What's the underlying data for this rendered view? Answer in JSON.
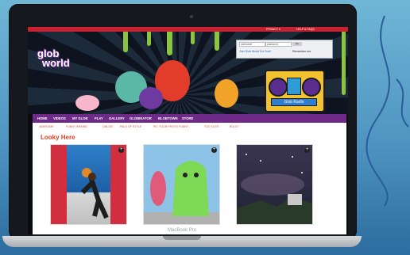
{
  "laptop": {
    "brand_text": "MacBook Pro"
  },
  "site": {
    "logo": {
      "line1": "glob",
      "line2": "world"
    },
    "topbar_links": [
      "PRIVACY ▾",
      "HELP & FAQS"
    ],
    "login": {
      "username_placeholder": "username",
      "password_placeholder": "password",
      "go": "Go",
      "forgot": "Join Glob World For Free!",
      "remember": "Remember me"
    },
    "boombox_label": "Glob Radio",
    "nav": {
      "items": [
        "HOME",
        "VIDEOS",
        "MY GLOB",
        "PLAY",
        "GALLERY",
        "GLOBINATOR",
        "BLOBTOWN",
        "STORE"
      ]
    },
    "subnav": {
      "items": [
        "AWESOME",
        "FUNNY BRAINS",
        "LIBLOB",
        "PALS OF STYLE",
        "PIC YOUR PHOTO FUNNY",
        "TOO CUTE",
        "BOLD!"
      ]
    },
    "section": {
      "heading": "Looky Here"
    },
    "thumbnails": [
      {
        "name": "basketball dunk",
        "plus": "+"
      },
      {
        "name": "green creature",
        "plus": "+"
      },
      {
        "name": "night sky",
        "plus": "+"
      }
    ]
  },
  "colors": {
    "topbar": "#c62130",
    "nav": "#6d2a86",
    "heading": "#e0401f",
    "logo_outline": "#6a2c8e"
  }
}
